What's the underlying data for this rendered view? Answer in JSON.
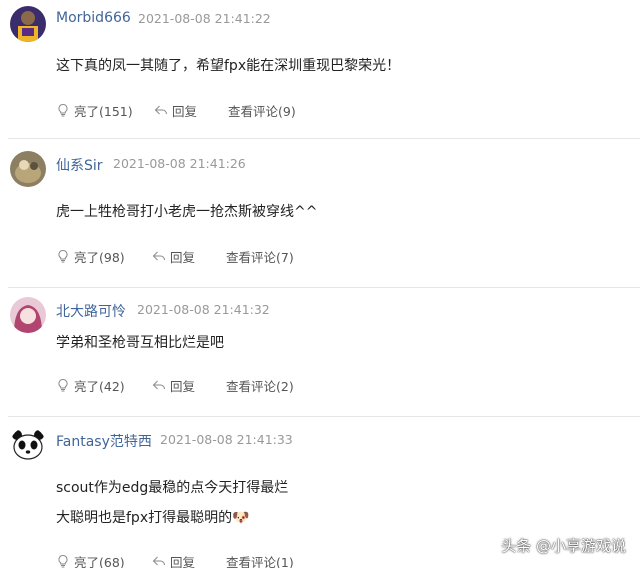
{
  "comments": [
    {
      "username": "Morbid666",
      "time": "2021-08-08 21:41:22",
      "lines": [
        "这下真的凤一其随了，希望fpx能在深圳重现巴黎荣光！"
      ],
      "like_label": "亮了(151)",
      "reply_label": "回复",
      "view_label": "查看评论(9)"
    },
    {
      "username": "仙系Sir",
      "time": "2021-08-08 21:41:26",
      "lines": [
        "虎一上牲枪哥打小老虎一抢杰斯被穿线^^"
      ],
      "like_label": "亮了(98)",
      "reply_label": "回复",
      "view_label": "查看评论(7)"
    },
    {
      "username": "北大路可怜",
      "time": "2021-08-08 21:41:32",
      "lines": [
        "学弟和圣枪哥互相比烂是吧"
      ],
      "like_label": "亮了(42)",
      "reply_label": "回复",
      "view_label": "查看评论(2)"
    },
    {
      "username": "Fantasy范特西",
      "time": "2021-08-08 21:41:33",
      "lines": [
        "scout作为edg最稳的点今天打得最烂",
        "大聪明也是fpx打得最聪明的🐶"
      ],
      "like_label": "亮了(68)",
      "reply_label": "回复",
      "view_label": "查看评论(1)"
    }
  ],
  "watermark": "头条 @小享游戏说",
  "colors": {
    "username": "#406599",
    "timestamp": "#999999",
    "divider": "#e6e6e6"
  }
}
